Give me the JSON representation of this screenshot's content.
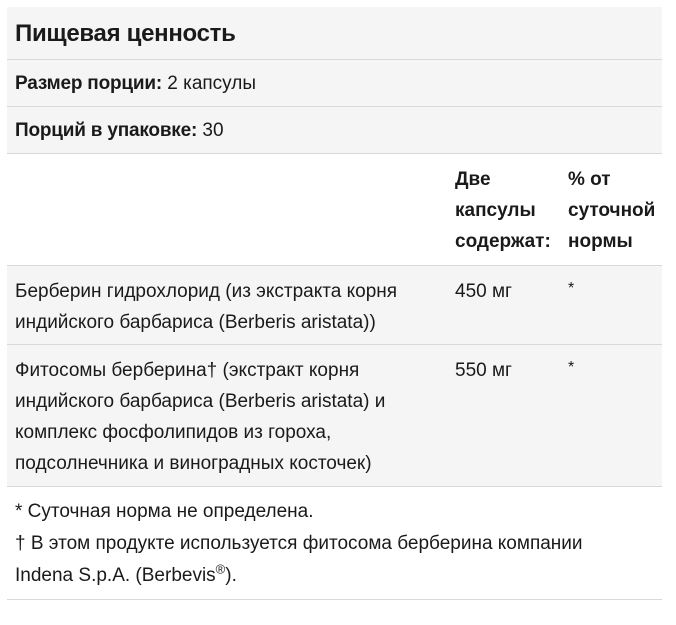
{
  "title": "Пищевая ценность",
  "serving_size": {
    "label": "Размер порции:",
    "value": " 2 капсулы"
  },
  "servings_per_container": {
    "label": "Порций в упаковке:",
    "value": " 30"
  },
  "header": {
    "amount_lines": [
      "Две",
      "капсулы",
      "содержат:"
    ],
    "dv_lines": [
      "% от",
      "суточной",
      "нормы"
    ]
  },
  "ingredients": [
    {
      "name_lines": [
        "Берберин гидрохлорид (из экстракта корня",
        "индийского барбариса (Berberis aristata))"
      ],
      "amount": "450 мг",
      "dv": "*"
    },
    {
      "name_lines": [
        "Фитосомы берберина† (экстракт корня",
        "индийского барбариса (Berberis aristata) и",
        "комплекс фосфолипидов из гороха,",
        "подсолнечника и виноградных косточек)"
      ],
      "amount": "550 мг",
      "dv": "*"
    }
  ],
  "footnotes": {
    "dv_note": "* Суточная норма не определена.",
    "phytosome_note_line1": "† В этом продукте используется фитосома берберина компании",
    "phytosome_note_line2_pre": "Indena S.p.A. (Berbevis",
    "registered_mark": "®",
    "phytosome_note_line2_post": ")."
  }
}
